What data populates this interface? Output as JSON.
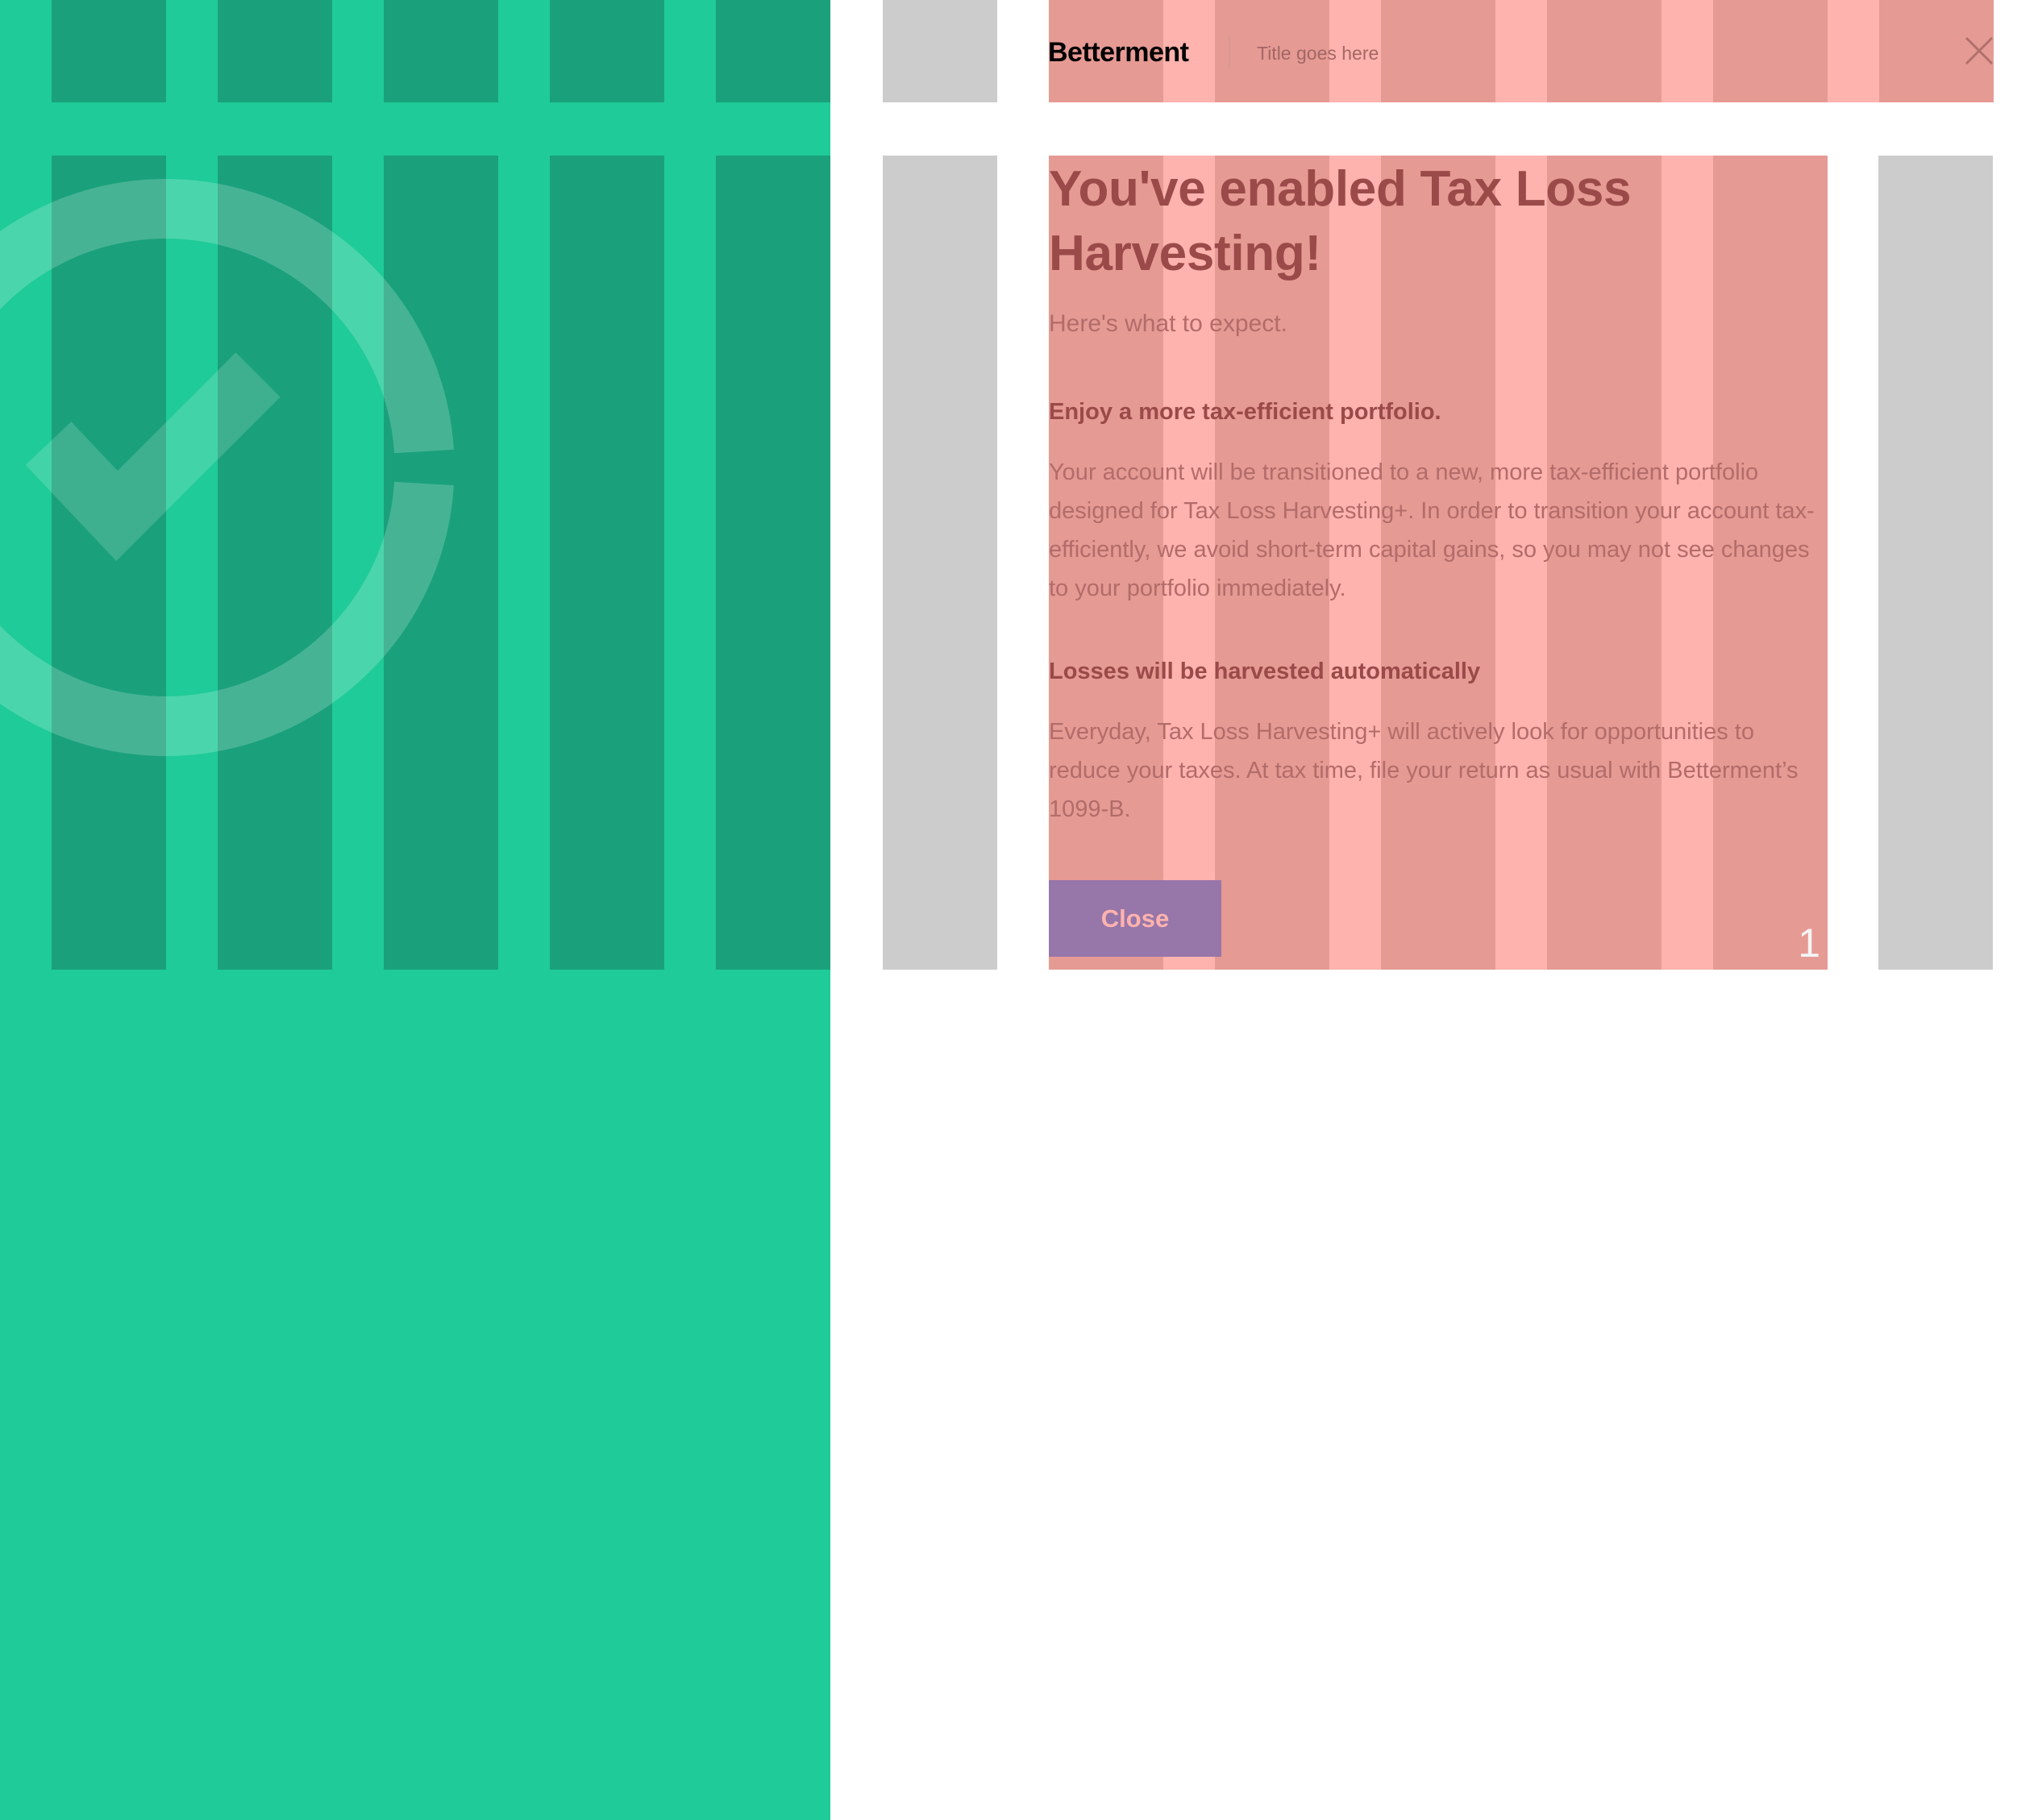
{
  "header": {
    "brand": "Betterment",
    "title": "Title goes here",
    "close_icon": "close-icon"
  },
  "content": {
    "headline": "You've enabled Tax Loss Harvesting!",
    "subhead": "Here's what to expect.",
    "sections": [
      {
        "title": "Enjoy a more tax-efficient portfolio.",
        "body": "Your account will be transitioned to a new, more tax-efficient portfolio designed for Tax Loss Harvesting+. In order to transition your account tax-efficiently, we avoid short-term capital gains, so you may not see changes to your portfolio immediately."
      },
      {
        "title": "Losses will be harvested automatically",
        "body": "Everyday, Tax Loss Harvesting+ will actively look for opportunities to reduce your taxes. At tax time, file your return as usual with Betterment’s 1099-B."
      }
    ],
    "close_button": "Close",
    "page_number": "1"
  },
  "illustration": {
    "icon": "checkmark-circle-icon"
  },
  "colors": {
    "panel_green": "#1fcb98",
    "grid_dark_green": "#1aa17b",
    "grid_gray": "#cccccc",
    "grid_red_light": "#ffb3ae",
    "grid_red_dark": "#e69a94",
    "heading_text": "#9a4a48",
    "body_text": "#b26c69",
    "button_purple": "#9776a9",
    "button_text": "#ffb3ae"
  }
}
